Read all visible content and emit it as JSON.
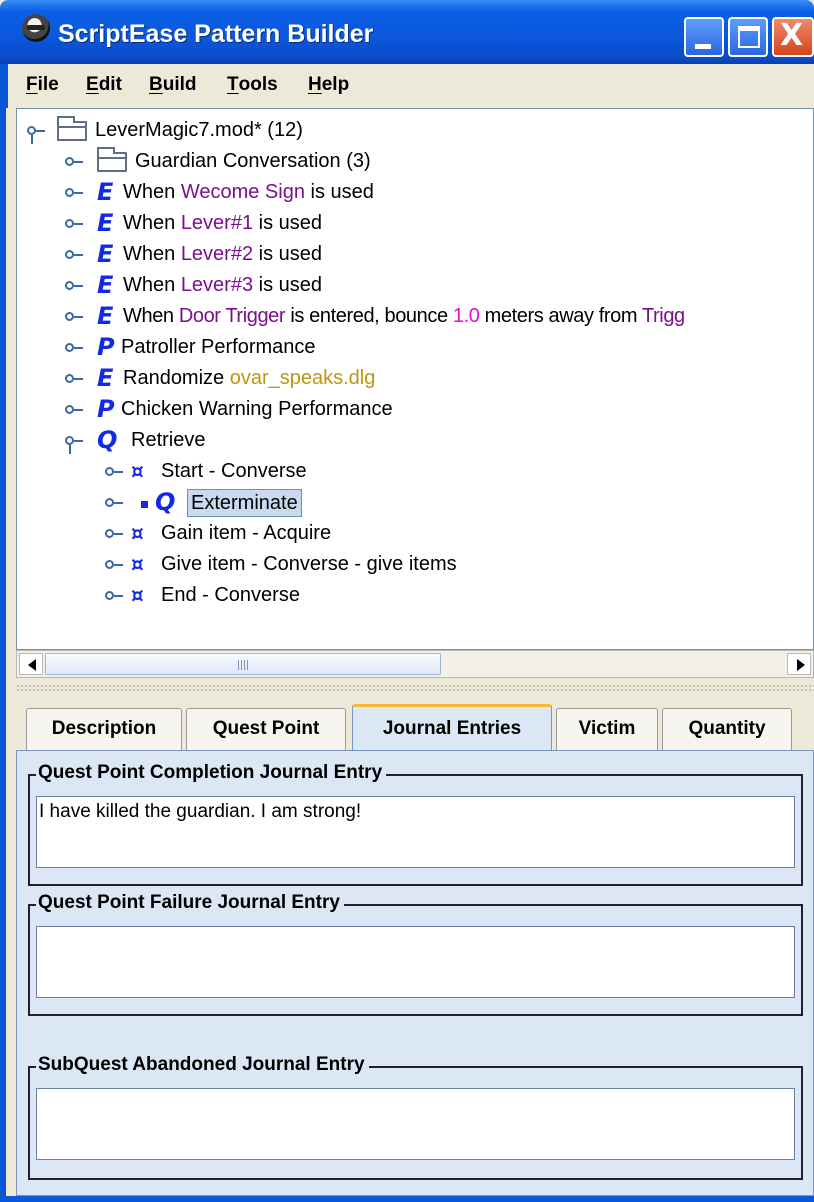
{
  "window": {
    "title": "ScriptEase Pattern Builder",
    "min_glyph": "",
    "close_glyph": "X"
  },
  "menu": [
    {
      "underline": "F",
      "rest": "ile"
    },
    {
      "underline": "E",
      "rest": "dit"
    },
    {
      "underline": "B",
      "rest": "uild"
    },
    {
      "underline": "T",
      "rest": "ools"
    },
    {
      "underline": "H",
      "rest": "elp"
    }
  ],
  "tree": {
    "root": {
      "label": "LeverMagic7.mod* (12)"
    },
    "items": [
      {
        "type": "folder",
        "text": "Guardian Conversation (3)"
      },
      {
        "type": "E",
        "before": "When ",
        "highlight": "Wecome Sign",
        "after": " is used"
      },
      {
        "type": "E",
        "before": "When ",
        "highlight": "Lever#1",
        "after": " is used"
      },
      {
        "type": "E",
        "before": "When ",
        "highlight": "Lever#2",
        "after": " is used"
      },
      {
        "type": "E",
        "before": "When ",
        "highlight": "Lever#3",
        "after": " is used"
      },
      {
        "type": "E",
        "before": "When ",
        "highlight": "Door Trigger",
        "middle": " is entered, bounce ",
        "value": "1.0",
        "after": " meters away from ",
        "tail": "Trigg"
      },
      {
        "type": "P",
        "text": "Patroller Performance"
      },
      {
        "type": "E",
        "before": "Randomize ",
        "file": "ovar_speaks.dlg"
      },
      {
        "type": "P",
        "text": "Chicken Warning Performance"
      },
      {
        "type": "Q",
        "text": "Retrieve"
      }
    ],
    "children": [
      {
        "type": "star",
        "text": "Start - Converse"
      },
      {
        "type": "Q",
        "text": "Exterminate",
        "selected": true
      },
      {
        "type": "star",
        "text": "Gain item - Acquire"
      },
      {
        "type": "star",
        "text": "Give item - Converse - give items"
      },
      {
        "type": "star",
        "text": "End - Converse"
      }
    ],
    "glyphs": {
      "E": "E",
      "P": "P",
      "Q": "Q",
      "star": "¤"
    }
  },
  "tabs": [
    "Description",
    "Quest Point",
    "Journal Entries",
    "Victim",
    "Quantity"
  ],
  "active_tab": "Journal Entries",
  "journal": {
    "completion_title": "Quest Point Completion Journal Entry",
    "completion_value": "I have killed the guardian.  I am strong!",
    "failure_title": "Quest Point Failure Journal Entry",
    "failure_value": "",
    "abandoned_title": "SubQuest Abandoned Journal Entry",
    "abandoned_value": ""
  },
  "colors": {
    "titlebar": "#0B57DB",
    "highlight_purple": "#7B0F8C",
    "value_pink": "#E40ED8",
    "file_gold": "#C09511",
    "icon_blue": "#1428e8",
    "tab_accent": "#F5B733"
  }
}
